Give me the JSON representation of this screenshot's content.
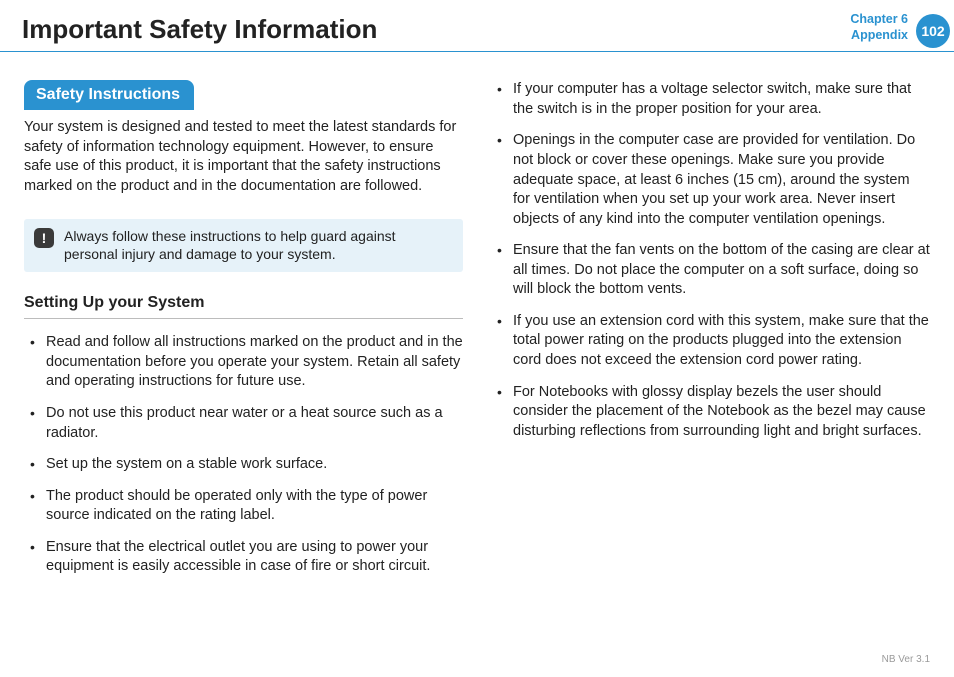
{
  "header": {
    "title": "Important Safety Information",
    "chapter_line1": "Chapter 6",
    "chapter_line2": "Appendix",
    "page_number": "102"
  },
  "left": {
    "section_label": "Safety Instructions",
    "intro": "Your system is designed and tested to meet the latest standards for safety of information technology equipment. However, to ensure safe use of this product, it is important that the safety instructions marked on the product and in the documentation are followed.",
    "callout_icon": "!",
    "callout_text": "Always follow these instructions to help guard against personal injury and damage to your system.",
    "subhead": "Setting Up your System",
    "bullets": [
      "Read and follow all instructions marked on the product and in the documentation before you operate your system. Retain all safety and operating instructions for future use.",
      "Do not use this product near water or a heat source such as a radiator.",
      "Set up the system on a stable work surface.",
      "The product should be operated only with the type of power source indicated on the rating label.",
      "Ensure that the electrical outlet you are using to power your equipment is easily accessible in case of fire or short circuit."
    ]
  },
  "right": {
    "bullets": [
      "If your computer has a voltage selector switch, make sure that the switch is in the proper position for your area.",
      "Openings in the computer case are provided for ventilation. Do not block or cover these openings. Make sure you provide adequate space, at least 6 inches (15 cm), around the system for ventilation when you set up your work area. Never insert objects of any kind into the computer ventilation openings.",
      "Ensure that the fan vents on the bottom of the casing are clear at all times. Do not place the computer on a soft surface, doing so will block the bottom vents.",
      "If you use an extension cord with this system, make sure that the total power rating on the products plugged into the extension cord does not exceed the extension cord power rating.",
      "For Notebooks with glossy display bezels the user should consider the placement of the Notebook as the bezel may cause disturbing reflections from surrounding light and bright surfaces."
    ]
  },
  "footer": {
    "version": "NB Ver 3.1"
  }
}
